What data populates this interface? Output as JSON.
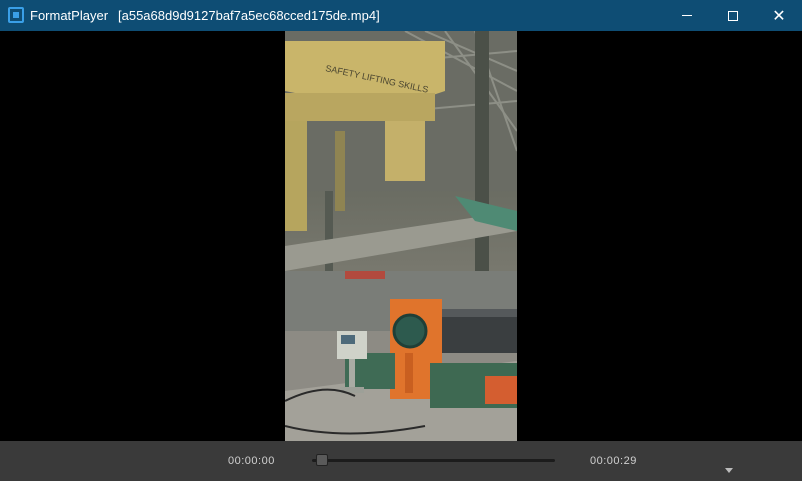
{
  "window": {
    "app_name": "FormatPlayer",
    "file_name": "[a55a68d9d9127baf7a5ec68cced175de.mp4]",
    "app_icon": "video-player-icon",
    "controls": [
      "minimize-icon",
      "maximize-icon",
      "close-icon"
    ]
  },
  "player": {
    "current_time": "00:00:00",
    "total_time": "00:00:29",
    "progress": 0.0,
    "menu_icon": "chevron-down-icon"
  },
  "video": {
    "description_icon": "video-frame"
  },
  "colors": {
    "titlebar": "#0e4d74",
    "controlbar": "#3a3a3a",
    "accent": "#3aa0e8"
  }
}
